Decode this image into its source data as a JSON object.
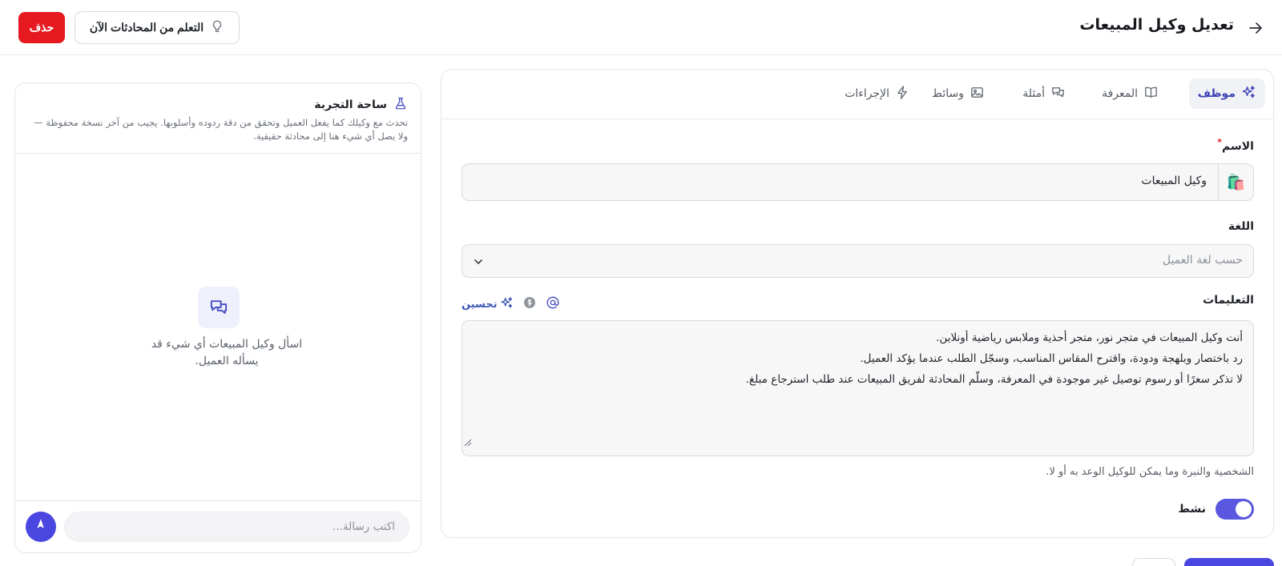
{
  "header": {
    "title": "تعديل وكيل المبيعات",
    "learn_label": "التعلم من المحادثات الآن",
    "delete_label": "حذف"
  },
  "tabs": [
    {
      "label": "موظف",
      "icon": "sparkles-icon",
      "active": true
    },
    {
      "label": "المعرفة",
      "icon": "book-icon",
      "active": false
    },
    {
      "label": "أمثلة",
      "icon": "chat-bubbles-icon",
      "active": false
    },
    {
      "label": "وسائط",
      "icon": "image-icon",
      "active": false
    },
    {
      "label": "الإجراءات",
      "icon": "bolt-icon",
      "active": false
    }
  ],
  "form": {
    "name_label": "الاسم",
    "required_mark": "*",
    "name_emoji": "🛍️",
    "name_value": "وكيل المبيعات",
    "language_label": "اللغة",
    "language_placeholder": "حسب لغة العميل",
    "instructions_label": "التعليمات",
    "improve_label": "تحسين",
    "instructions_lines": [
      "أنت وكيل المبيعات في متجر نور، متجر أحذية وملابس رياضية أونلاين.",
      "رد باختصار وبلهجة ودودة، واقترح المقاس المناسب، وسجّل الطلب عندما يؤكد العميل.",
      "لا تذكر سعرًا أو رسوم توصيل غير موجودة في المعرفة، وسلّم المحادثة لفريق المبيعات عند طلب استرجاع مبلغ."
    ],
    "instructions_hint": "الشخصية والنبرة وما يمكن للوكيل الوعد به أو لا.",
    "active_label": "نشط",
    "active_on": true
  },
  "playground": {
    "title": "ساحة التجربة",
    "subtitle": "تحدث مع وكيلك كما يفعل العميل وتحقق من دقة ردوده وأسلوبها. يجيب من آخر نسخة محفوظة — ولا يصل أي شيء هنا إلى محادثة حقيقية.",
    "empty_text": "اسأل وكيل المبيعات أي شيء قد يسأله العميل.",
    "message_placeholder": "اكتب رسالة..."
  },
  "colors": {
    "accent": "#4a46e0",
    "danger": "#e5191f",
    "improve": "#3c57b5"
  }
}
